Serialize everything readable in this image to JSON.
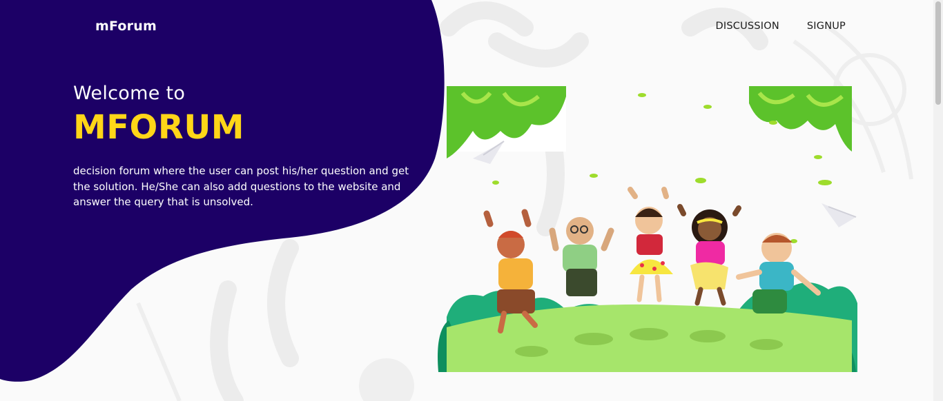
{
  "brand": {
    "name": "mForum"
  },
  "nav": {
    "items": [
      "DISCUSSION",
      "SIGNUP"
    ]
  },
  "hero": {
    "welcome": "Welcome to",
    "title": "MFORUM",
    "description": "decision forum where the user can post his/her question and get the solution. He/She can also add questions to the website and answer the query that is unsolved."
  },
  "colors": {
    "blob": "#1c0066",
    "accent_yellow": "#ffd618",
    "page_background": "#fafafa",
    "nav_text": "#1b1b1b"
  },
  "illustration": {
    "subject": "five-happy-children-jumping-on-grass-hill"
  }
}
